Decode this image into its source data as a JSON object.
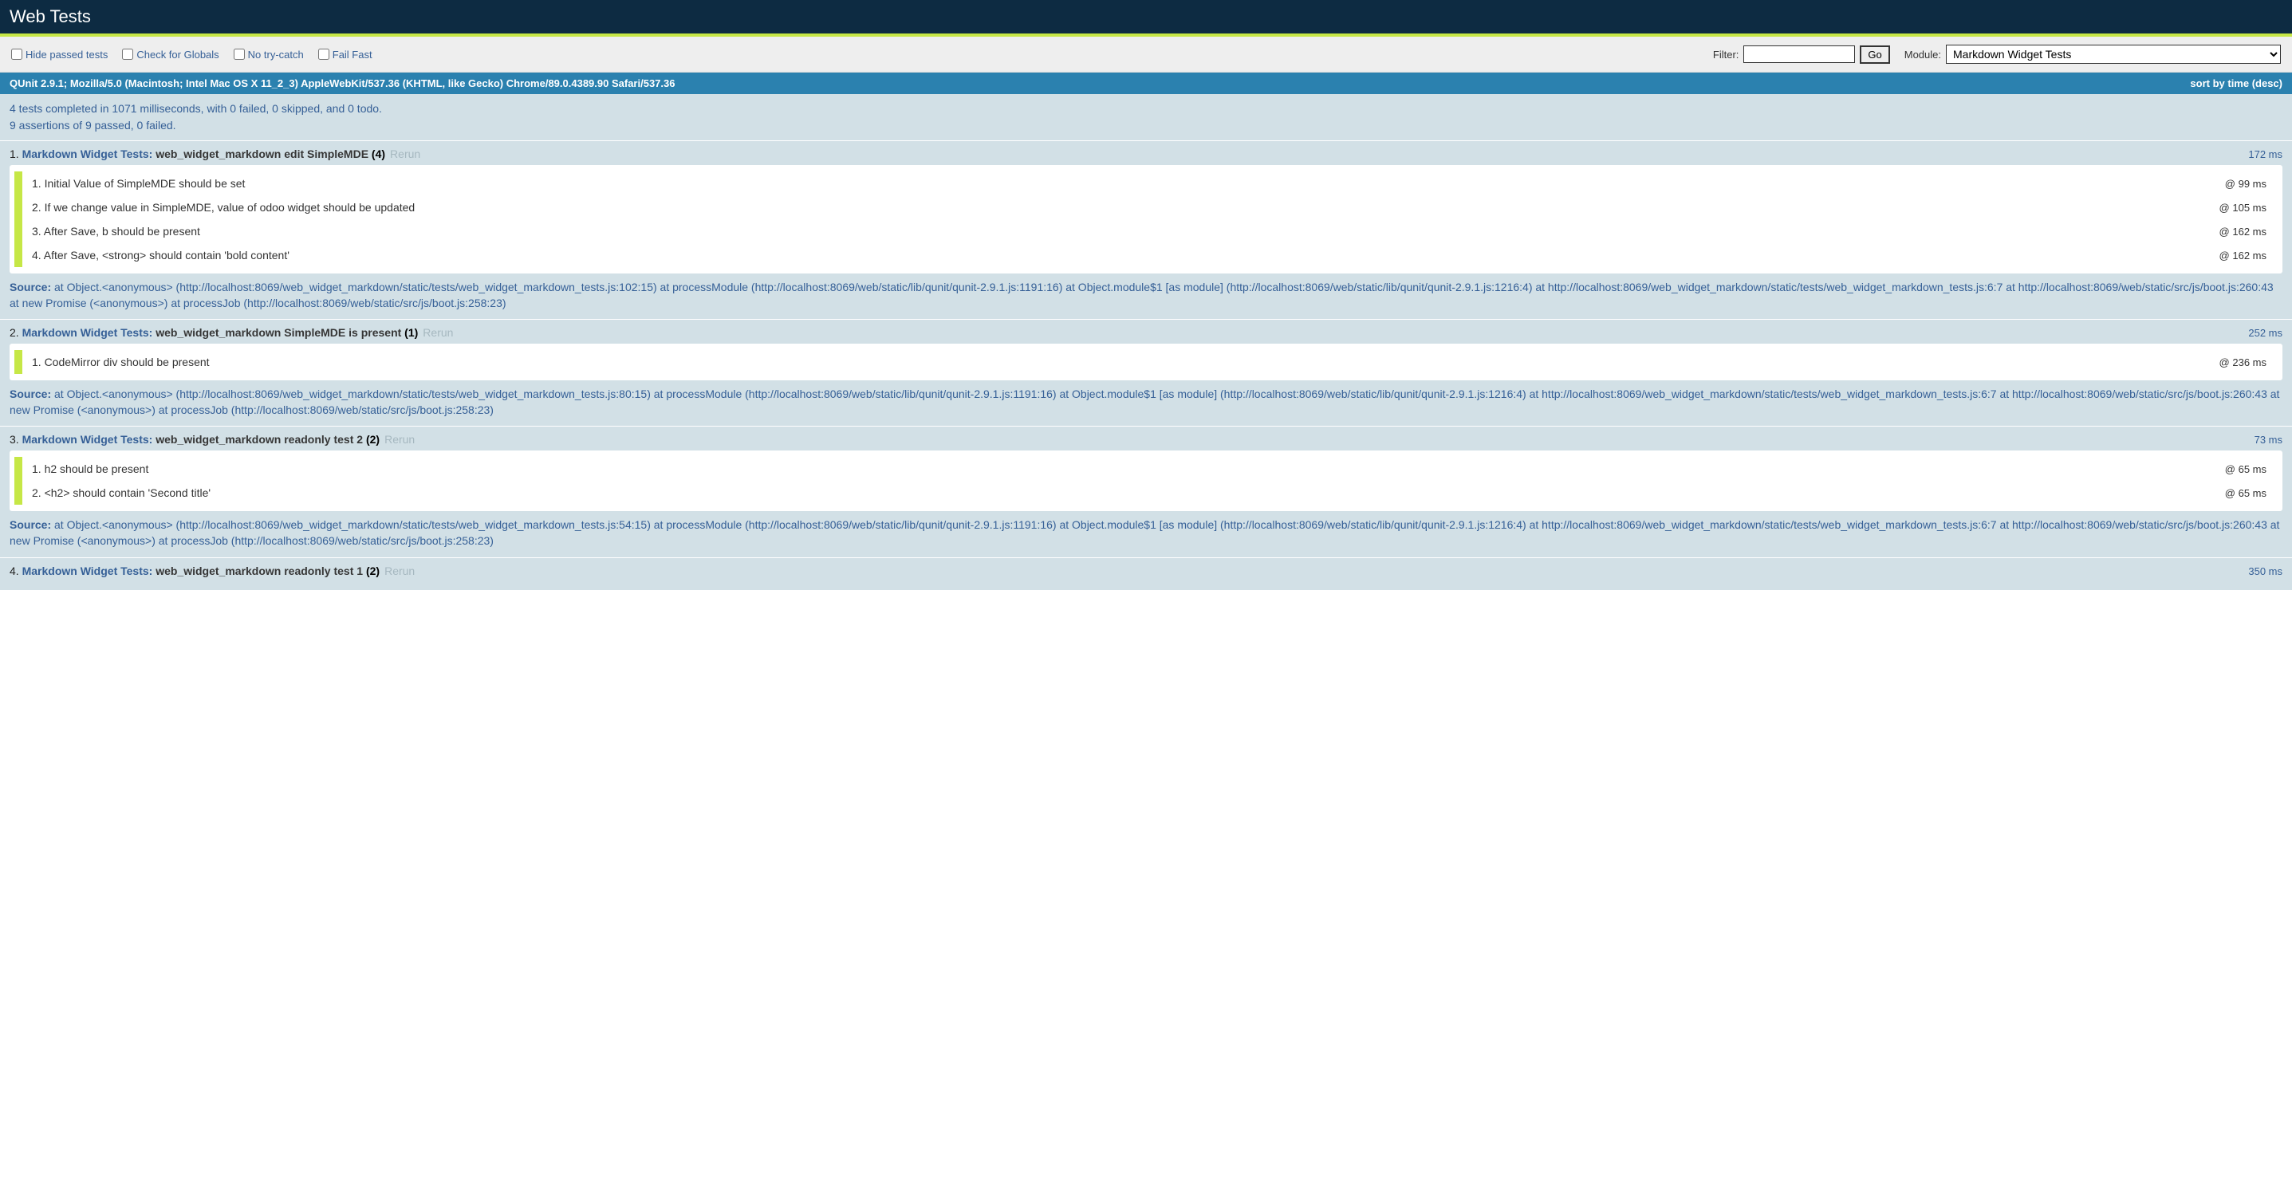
{
  "header": {
    "title": "Web Tests"
  },
  "toolbar": {
    "checkboxes": [
      {
        "id": "hide-passed",
        "label": "Hide passed tests"
      },
      {
        "id": "check-globals",
        "label": "Check for Globals"
      },
      {
        "id": "no-trycatch",
        "label": "No try-catch"
      },
      {
        "id": "fail-fast",
        "label": "Fail Fast"
      }
    ],
    "filter_label": "Filter:",
    "filter_value": "",
    "go_label": "Go",
    "module_label": "Module:",
    "module_selected": "Markdown Widget Tests"
  },
  "banner": {
    "text": "QUnit 2.9.1; Mozilla/5.0 (Macintosh; Intel Mac OS X 11_2_3) AppleWebKit/537.36 (KHTML, like Gecko) Chrome/89.0.4389.90 Safari/537.36",
    "sort": "sort by time (desc)"
  },
  "summary": {
    "line1": "4 tests completed in 1071 milliseconds, with 0 failed, 0 skipped, and 0 todo.",
    "line2": "9 assertions of 9 passed, 0 failed."
  },
  "rerun_label": "Rerun",
  "source_label": "Source:",
  "tests": [
    {
      "num": "1.",
      "module": "Markdown Widget Tests:",
      "name": "web_widget_markdown edit SimpleMDE",
      "count": "(4)",
      "runtime": "172 ms",
      "assertions": [
        {
          "idx": "1.",
          "msg": "Initial Value of SimpleMDE should be set",
          "time": "@ 99 ms"
        },
        {
          "idx": "2.",
          "msg": "If we change value in SimpleMDE, value of odoo widget should be updated",
          "time": "@ 105 ms"
        },
        {
          "idx": "3.",
          "msg": "After Save, b should be present",
          "time": "@ 162 ms"
        },
        {
          "idx": "4.",
          "msg": "After Save, <strong> should contain 'bold content'",
          "time": "@ 162 ms"
        }
      ],
      "source": "at Object.<anonymous> (http://localhost:8069/web_widget_markdown/static/tests/web_widget_markdown_tests.js:102:15) at processModule (http://localhost:8069/web/static/lib/qunit/qunit-2.9.1.js:1191:16) at Object.module$1 [as module] (http://localhost:8069/web/static/lib/qunit/qunit-2.9.1.js:1216:4) at http://localhost:8069/web_widget_markdown/static/tests/web_widget_markdown_tests.js:6:7 at http://localhost:8069/web/static/src/js/boot.js:260:43 at new Promise (<anonymous>) at processJob (http://localhost:8069/web/static/src/js/boot.js:258:23)"
    },
    {
      "num": "2.",
      "module": "Markdown Widget Tests:",
      "name": "web_widget_markdown SimpleMDE is present",
      "count": "(1)",
      "runtime": "252 ms",
      "assertions": [
        {
          "idx": "1.",
          "msg": "CodeMirror div should be present",
          "time": "@ 236 ms"
        }
      ],
      "source": "at Object.<anonymous> (http://localhost:8069/web_widget_markdown/static/tests/web_widget_markdown_tests.js:80:15) at processModule (http://localhost:8069/web/static/lib/qunit/qunit-2.9.1.js:1191:16) at Object.module$1 [as module] (http://localhost:8069/web/static/lib/qunit/qunit-2.9.1.js:1216:4) at http://localhost:8069/web_widget_markdown/static/tests/web_widget_markdown_tests.js:6:7 at http://localhost:8069/web/static/src/js/boot.js:260:43 at new Promise (<anonymous>) at processJob (http://localhost:8069/web/static/src/js/boot.js:258:23)"
    },
    {
      "num": "3.",
      "module": "Markdown Widget Tests:",
      "name": "web_widget_markdown readonly test 2",
      "count": "(2)",
      "runtime": "73 ms",
      "assertions": [
        {
          "idx": "1.",
          "msg": "h2 should be present",
          "time": "@ 65 ms"
        },
        {
          "idx": "2.",
          "msg": "<h2> should contain 'Second title'",
          "time": "@ 65 ms"
        }
      ],
      "source": "at Object.<anonymous> (http://localhost:8069/web_widget_markdown/static/tests/web_widget_markdown_tests.js:54:15) at processModule (http://localhost:8069/web/static/lib/qunit/qunit-2.9.1.js:1191:16) at Object.module$1 [as module] (http://localhost:8069/web/static/lib/qunit/qunit-2.9.1.js:1216:4) at http://localhost:8069/web_widget_markdown/static/tests/web_widget_markdown_tests.js:6:7 at http://localhost:8069/web/static/src/js/boot.js:260:43 at new Promise (<anonymous>) at processJob (http://localhost:8069/web/static/src/js/boot.js:258:23)"
    },
    {
      "num": "4.",
      "module": "Markdown Widget Tests:",
      "name": "web_widget_markdown readonly test 1",
      "count": "(2)",
      "runtime": "350 ms",
      "assertions": [],
      "source": ""
    }
  ]
}
